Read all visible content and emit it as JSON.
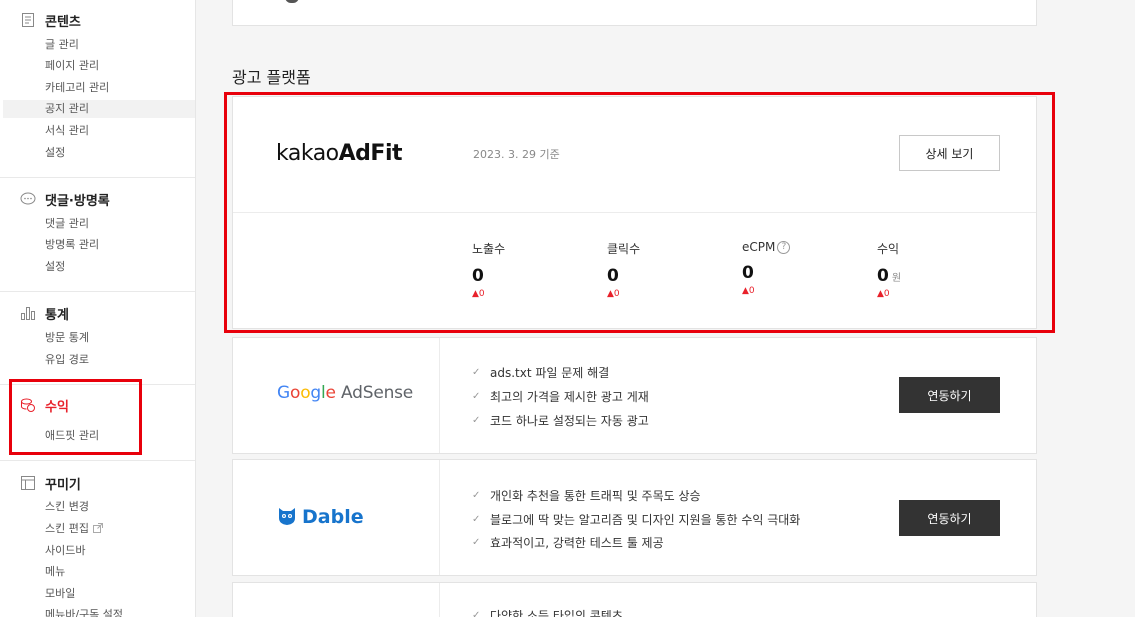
{
  "sidebar": {
    "sections": [
      {
        "title": "콘텐츠",
        "items": [
          "글 관리",
          "페이지 관리",
          "카테고리 관리",
          "공지 관리",
          "서식 관리",
          "설정"
        ]
      },
      {
        "title": "댓글·방명록",
        "items": [
          "댓글 관리",
          "방명록 관리",
          "설정"
        ]
      },
      {
        "title": "통계",
        "items": [
          "방문 통계",
          "유입 경로"
        ]
      },
      {
        "title": "수익",
        "items": [
          "애드핏 관리"
        ]
      },
      {
        "title": "꾸미기",
        "items": [
          "스킨 변경",
          "스킨 편집",
          "사이드바",
          "메뉴",
          "모바일",
          "메뉴바/구독 설정"
        ]
      }
    ],
    "accent_color": "#e8212b"
  },
  "main": {
    "section_title": "광고 플랫폼",
    "adfit": {
      "logo_light": "kakao",
      "logo_bold": "AdFit",
      "date": "2023. 3. 29 기준",
      "detail_button": "상세 보기",
      "stats": [
        {
          "label": "노출수",
          "value": "0",
          "delta": "▲0"
        },
        {
          "label": "클릭수",
          "value": "0",
          "delta": "▲0"
        },
        {
          "label": "eCPM",
          "value": "0",
          "delta": "▲0",
          "help": "?"
        },
        {
          "label": "수익",
          "value": "0",
          "unit": "원",
          "delta": "▲0"
        }
      ]
    },
    "adsense": {
      "logo_google": [
        "G",
        "o",
        "o",
        "g",
        "l",
        "e"
      ],
      "logo_product": "AdSense",
      "features": [
        "ads.txt 파일 문제 해결",
        "최고의 가격을 제시한 광고 게재",
        "코드 하나로 설정되는 자동 광고"
      ],
      "button": "연동하기"
    },
    "dable": {
      "logo": "Dable",
      "features": [
        "개인화 추천을 통한 트래픽 및 주목도 상승",
        "블로그에 딱 맞는 알고리즘 및 디자인 지원을 통한 수익 극대화",
        "효과적이고, 강력한 테스트 툴 제공"
      ],
      "button": "연동하기"
    },
    "next_card": {
      "features": [
        "다양한 소득 타입의 콘텐츠"
      ]
    }
  }
}
